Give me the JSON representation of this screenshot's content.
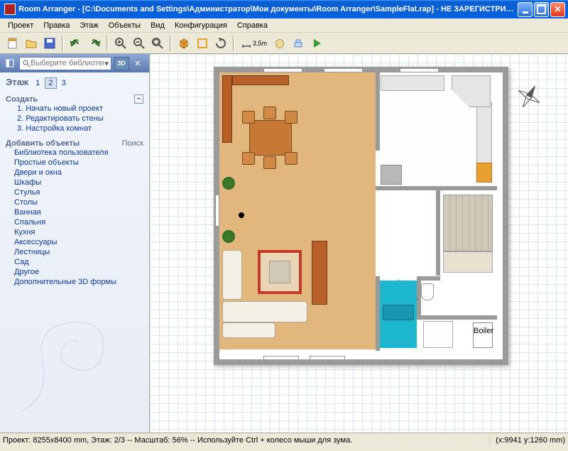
{
  "title": "Room Arranger - [C:\\Documents and Settings\\Администратор\\Мои документы\\Room Arranger\\SampleFlat.rap] - НЕ ЗАРЕГИСТРИРО...",
  "menu": [
    "Проект",
    "Правка",
    "Этаж",
    "Объекты",
    "Вид",
    "Конфигурация",
    "Справка"
  ],
  "toolbar": {
    "new": "new-icon",
    "open": "open-icon",
    "save": "save-icon",
    "undo": "undo-icon",
    "redo": "redo-icon",
    "zoomin": "zoom-in-icon",
    "zoomout": "zoom-out-icon",
    "fit": "zoom-fit-icon",
    "view3d": "cube-3d-icon",
    "walls": "walls-icon",
    "rotate": "rotate-icon",
    "measure": "measure-icon",
    "measure_label": "3,5m",
    "furnish": "furnish-icon",
    "walk": "walk-icon",
    "play": "play-icon"
  },
  "sidebar": {
    "search_placeholder": "Выберите библиотеку...",
    "threeD": "3D",
    "floor_label": "Этаж",
    "floors": [
      "1",
      "2",
      "3"
    ],
    "floor_selected": 1,
    "create_header": "Создать",
    "create_items": [
      "1. Начать новый проект",
      "2. Редактировать стены",
      "3. Настройка комнат"
    ],
    "addobj_header": "Добавить объекты",
    "search_label": "Поиск",
    "categories": [
      "Библиотека пользователя",
      "Простые объекты",
      "Двери и окна",
      "Шкафы",
      "Стулья",
      "Столы",
      "Ванная",
      "Спальня",
      "Кухня",
      "Аксессуары",
      "Лестницы",
      "Сад",
      "Другое",
      "Дополнительные 3D формы"
    ]
  },
  "status": {
    "left": "Проект: 8255x8400 mm, Этаж: 2/3 -- Масштаб: 56% -- Используйте Ctrl + колесо мыши для зума.",
    "right": "(x:9941 y:1260 mm)"
  },
  "boiler_label": "Boiler"
}
